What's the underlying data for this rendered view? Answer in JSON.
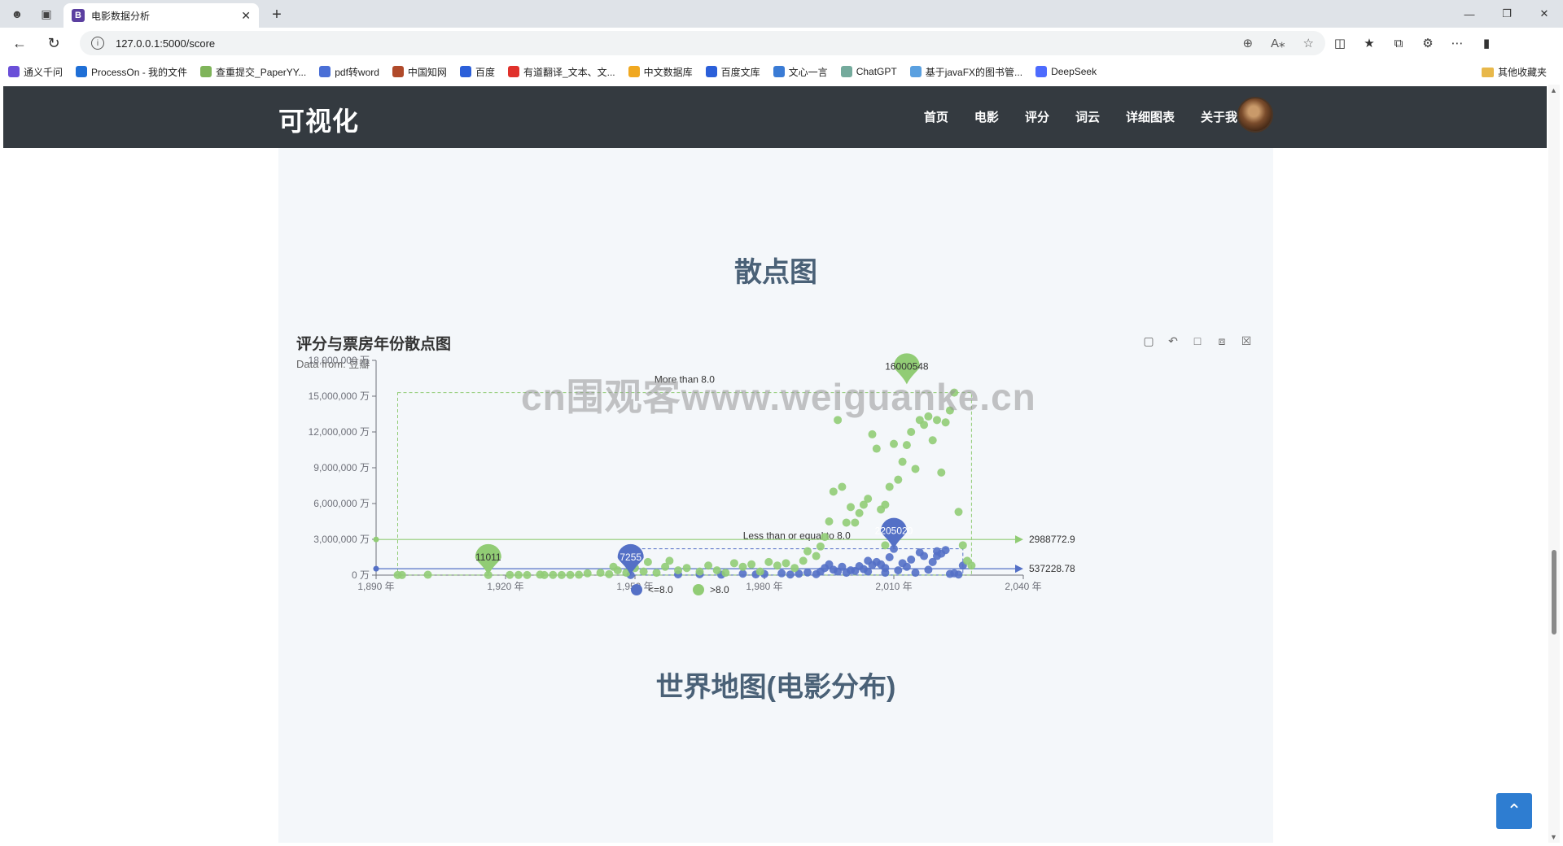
{
  "browser": {
    "tab_title": "电影数据分析",
    "tab_icon_letter": "B",
    "url": "127.0.0.1:5000/score",
    "bookmarks": [
      "通义千问",
      "ProcessOn - 我的文件",
      "查重提交_PaperYY...",
      "pdf转word",
      "中国知网",
      "百度",
      "有道翻译_文本、文...",
      "中文数据库",
      "百度文库",
      "文心一言",
      "ChatGPT",
      "基于javaFX的图书管...",
      "DeepSeek"
    ],
    "other_bookmarks": "其他收藏夹"
  },
  "nav": {
    "brand": "可视化",
    "items": [
      "首页",
      "电影",
      "评分",
      "词云",
      "详细图表",
      "关于我"
    ]
  },
  "sections": {
    "scatter_title": "散点图",
    "map_title": "世界地图(电影分布)"
  },
  "chart": {
    "title": "评分与票房年份散点图",
    "subtitle": "Data from: 豆瓣"
  },
  "watermark": "cn围观客www.weiguanke.cn",
  "chart_data": {
    "type": "scatter",
    "title": "评分与票房年份散点图",
    "subtitle": "Data from: 豆瓣",
    "xlim": [
      1890,
      2040
    ],
    "ylim": [
      0,
      18000000
    ],
    "x_ticks": [
      "1,890 年",
      "1,920 年",
      "1,950 年",
      "1,980 年",
      "2,010 年",
      "2,040 年"
    ],
    "y_ticks": [
      "0 万",
      "3,000,000 万",
      "6,000,000 万",
      "9,000,000 万",
      "12,000,000 万",
      "15,000,000 万",
      "18,000,000 万"
    ],
    "legend": [
      "<=8.0",
      ">8.0"
    ],
    "legend_position": "bottom-center",
    "grid": false,
    "series": [
      {
        "name": "<=8.0",
        "color": "#5470c6",
        "markline_avg": 537228.78,
        "markline_label": "537228.78",
        "markarea_label": "Less than or equal to 8.0",
        "markpoints": [
          {
            "x": 1949,
            "y": 7255,
            "label": "7255"
          },
          {
            "x": 2010,
            "y": 2205020,
            "label": "2205020"
          }
        ],
        "points": [
          [
            1949,
            7255
          ],
          [
            1960,
            60000
          ],
          [
            1965,
            80000
          ],
          [
            1970,
            40000
          ],
          [
            1975,
            120000
          ],
          [
            1978,
            60000
          ],
          [
            1980,
            90000
          ],
          [
            1984,
            150000
          ],
          [
            1986,
            50000
          ],
          [
            1988,
            120000
          ],
          [
            1990,
            220000
          ],
          [
            1992,
            80000
          ],
          [
            1993,
            300000
          ],
          [
            1994,
            600000
          ],
          [
            1995,
            900000
          ],
          [
            1996,
            450000
          ],
          [
            1997,
            300000
          ],
          [
            1998,
            700000
          ],
          [
            1999,
            200000
          ],
          [
            2000,
            400000
          ],
          [
            2001,
            350000
          ],
          [
            2002,
            750000
          ],
          [
            2003,
            500000
          ],
          [
            2004,
            1200000
          ],
          [
            2004,
            300000
          ],
          [
            2005,
            850000
          ],
          [
            2006,
            1100000
          ],
          [
            2007,
            900000
          ],
          [
            2008,
            200000
          ],
          [
            2008,
            600000
          ],
          [
            2009,
            1500000
          ],
          [
            2010,
            2205020
          ],
          [
            2011,
            400000
          ],
          [
            2012,
            1000000
          ],
          [
            2013,
            700000
          ],
          [
            2014,
            1300000
          ],
          [
            2015,
            200000
          ],
          [
            2016,
            1900000
          ],
          [
            2017,
            1600000
          ],
          [
            2018,
            450000
          ],
          [
            2019,
            1100000
          ],
          [
            2020,
            2000000
          ],
          [
            2020,
            1600000
          ],
          [
            2021,
            1800000
          ],
          [
            2022,
            2100000
          ],
          [
            2023,
            100000
          ],
          [
            2024,
            150000
          ],
          [
            2025,
            50000
          ],
          [
            2026,
            800000
          ]
        ]
      },
      {
        "name": ">8.0",
        "color": "#91cc75",
        "markline_avg": 2988772.9,
        "markline_label": "2988772.9",
        "markarea_label": "More than 8.0",
        "markpoints": [
          {
            "x": 1916,
            "y": 11011,
            "label": "11011"
          },
          {
            "x": 2013,
            "y": 16000548,
            "label": "16000548"
          }
        ],
        "points": [
          [
            1895,
            10000
          ],
          [
            1896,
            5000
          ],
          [
            1902,
            30000
          ],
          [
            1916,
            11011
          ],
          [
            1921,
            20000
          ],
          [
            1923,
            15000
          ],
          [
            1925,
            8000
          ],
          [
            1928,
            40000
          ],
          [
            1929,
            10000
          ],
          [
            1931,
            20000
          ],
          [
            1933,
            10000
          ],
          [
            1935,
            20000
          ],
          [
            1937,
            30000
          ],
          [
            1939,
            150000
          ],
          [
            1942,
            200000
          ],
          [
            1944,
            80000
          ],
          [
            1945,
            700000
          ],
          [
            1946,
            400000
          ],
          [
            1948,
            200000
          ],
          [
            1950,
            600000
          ],
          [
            1952,
            300000
          ],
          [
            1953,
            1100000
          ],
          [
            1955,
            200000
          ],
          [
            1957,
            700000
          ],
          [
            1958,
            1200000
          ],
          [
            1960,
            400000
          ],
          [
            1962,
            600000
          ],
          [
            1965,
            300000
          ],
          [
            1967,
            800000
          ],
          [
            1969,
            400000
          ],
          [
            1971,
            200000
          ],
          [
            1973,
            1000000
          ],
          [
            1975,
            700000
          ],
          [
            1977,
            900000
          ],
          [
            1979,
            300000
          ],
          [
            1981,
            1100000
          ],
          [
            1983,
            800000
          ],
          [
            1985,
            1000000
          ],
          [
            1987,
            600000
          ],
          [
            1989,
            1200000
          ],
          [
            1990,
            2000000
          ],
          [
            1992,
            1600000
          ],
          [
            1993,
            2400000
          ],
          [
            1994,
            3200000
          ],
          [
            1995,
            4500000
          ],
          [
            1996,
            7000000
          ],
          [
            1997,
            13000000
          ],
          [
            1998,
            7400000
          ],
          [
            1999,
            4400000
          ],
          [
            2000,
            5700000
          ],
          [
            2001,
            4400000
          ],
          [
            2002,
            5200000
          ],
          [
            2003,
            5900000
          ],
          [
            2004,
            6400000
          ],
          [
            2005,
            11800000
          ],
          [
            2006,
            10600000
          ],
          [
            2007,
            5500000
          ],
          [
            2008,
            5900000
          ],
          [
            2008,
            2500000
          ],
          [
            2009,
            7400000
          ],
          [
            2010,
            11000000
          ],
          [
            2011,
            8000000
          ],
          [
            2012,
            9500000
          ],
          [
            2013,
            10900000
          ],
          [
            2014,
            12000000
          ],
          [
            2015,
            8900000
          ],
          [
            2016,
            13000000
          ],
          [
            2017,
            12600000
          ],
          [
            2018,
            13300000
          ],
          [
            2019,
            11300000
          ],
          [
            2020,
            13000000
          ],
          [
            2021,
            8600000
          ],
          [
            2022,
            12800000
          ],
          [
            2023,
            13800000
          ],
          [
            2024,
            15300000
          ],
          [
            2025,
            5300000
          ],
          [
            2026,
            2500000
          ],
          [
            2027,
            1200000
          ],
          [
            2028,
            800000
          ]
        ]
      }
    ]
  }
}
